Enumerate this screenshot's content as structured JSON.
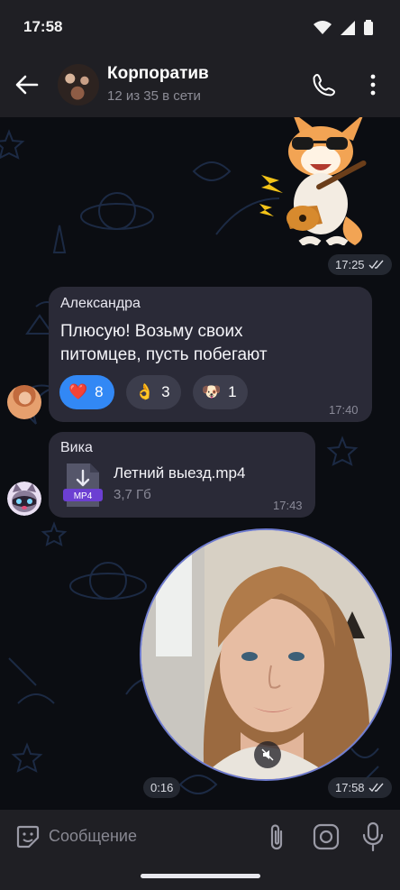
{
  "status_bar": {
    "time": "17:58"
  },
  "header": {
    "title": "Корпоратив",
    "subtitle": "12 из 35 в сети"
  },
  "messages": {
    "sticker_time": "17:25",
    "alexandra": {
      "sender": "Александра",
      "text_line1": "Плюсую! Возьму своих",
      "text_line2": "питомцев, пусть побегают",
      "time": "17:40",
      "reactions": [
        {
          "emoji": "❤️",
          "count": "8"
        },
        {
          "emoji": "👌",
          "count": "3"
        },
        {
          "emoji": "🐶",
          "count": "1"
        }
      ]
    },
    "vika": {
      "sender": "Вика",
      "file_name": "Летний выезд.mp4",
      "file_ext": "MP4",
      "file_size": "3,7 Гб",
      "time": "17:43"
    },
    "video": {
      "duration": "0:16",
      "time": "17:58"
    }
  },
  "input": {
    "placeholder": "Сообщение"
  },
  "colors": {
    "accent": "#3288f5",
    "bubble": "#2a2a37",
    "bar": "#1f1f24"
  }
}
